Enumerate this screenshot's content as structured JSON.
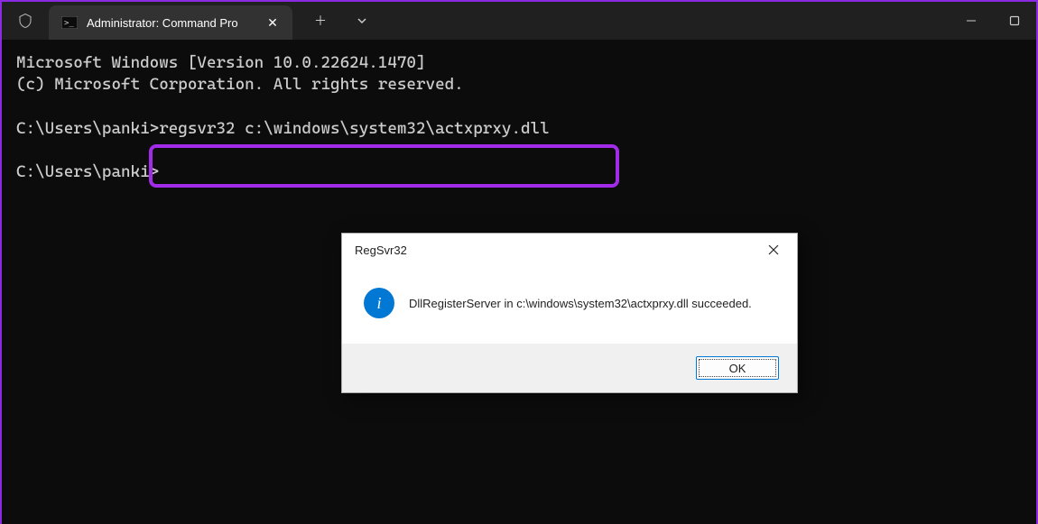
{
  "titlebar": {
    "tab_title": "Administrator: Command Pro",
    "tab_close_glyph": "✕",
    "newtab_glyph": "＋",
    "dropdown_glyph": "⌄",
    "minimize_glyph": "—",
    "maximize_glyph": "▢",
    "close_glyph": "✕"
  },
  "terminal": {
    "line1": "Microsoft Windows [Version 10.0.22624.1470]",
    "line2": "(c) Microsoft Corporation. All rights reserved.",
    "blank1": "",
    "line3": "C:\\Users\\panki>regsvr32 c:\\windows\\system32\\actxprxy.dll",
    "blank2": "",
    "line4": "C:\\Users\\panki>"
  },
  "highlight": {
    "command": "regsvr32 c:\\windows\\system32\\actxprxy.dll"
  },
  "dialog": {
    "title": "RegSvr32",
    "message": "DllRegisterServer in c:\\windows\\system32\\actxprxy.dll succeeded.",
    "ok_label": "OK",
    "close_glyph": "✕",
    "info_glyph": "i"
  }
}
